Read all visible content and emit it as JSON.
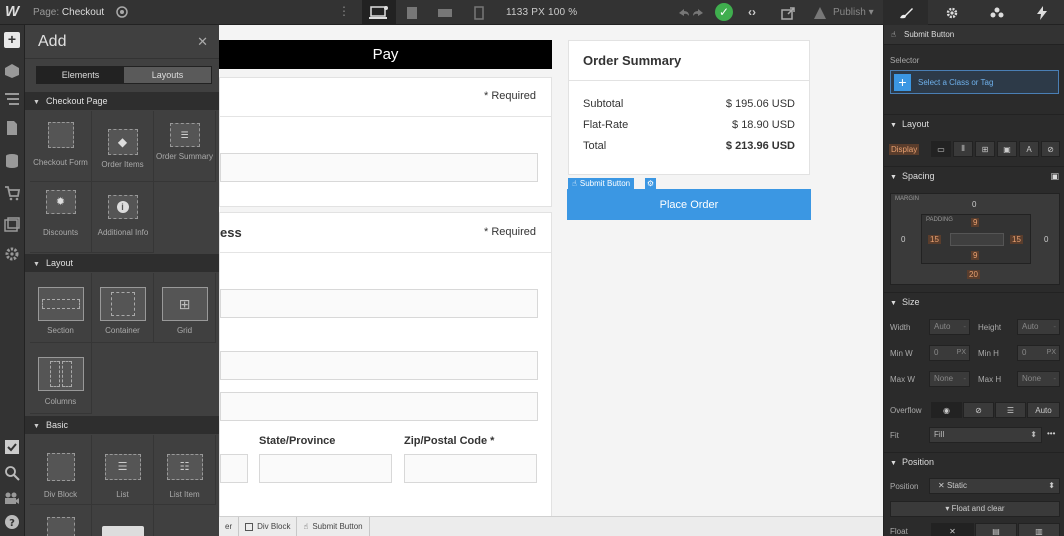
{
  "topbar": {
    "logo": "W",
    "page_prefix": "Page:",
    "page_name": "Checkout",
    "dimensions": "1133 PX  100 %",
    "publish_label": "Publish"
  },
  "add_panel": {
    "title": "Add",
    "close": "✕",
    "tabs": [
      "Elements",
      "Layouts"
    ],
    "sections": [
      {
        "title": "Checkout Page",
        "items": [
          "Checkout Form",
          "Order Items",
          "Order Summary",
          "Discounts",
          "Additional Info"
        ]
      },
      {
        "title": "Layout",
        "items": [
          "Section",
          "Container",
          "Grid",
          "Columns"
        ]
      },
      {
        "title": "Basic",
        "items": [
          "Div Block",
          "List",
          "List Item"
        ]
      }
    ]
  },
  "canvas": {
    "apple_pay": " Pay",
    "required_label": "* Required",
    "section_title_fragment": "ess",
    "state_label": "State/Province",
    "zip_label": "Zip/Postal Code *",
    "order_summary": {
      "title": "Order Summary",
      "rows": [
        {
          "label": "Subtotal",
          "value": "$ 195.06 USD"
        },
        {
          "label": "Flat-Rate",
          "value": "$ 18.90 USD"
        },
        {
          "label": "Total",
          "value": "$ 213.96 USD"
        }
      ]
    },
    "submit_tag": "Submit Button",
    "place_order": "Place Order"
  },
  "breadcrumbs": [
    "er",
    "Div Block",
    "Submit Button"
  ],
  "right_panel": {
    "element": "Submit Button",
    "selector_label": "Selector",
    "selector_placeholder": "Select a Class or Tag",
    "layout_title": "Layout",
    "display_label": "Display",
    "spacing_title": "Spacing",
    "margin_label": "MARGIN",
    "padding_label": "PADDING",
    "margin": {
      "top": "0",
      "right": "0",
      "bottom": "20",
      "left": "0"
    },
    "padding": {
      "top": "9",
      "right": "15",
      "bottom": "9",
      "left": "15"
    },
    "size_title": "Size",
    "size": {
      "width_label": "Width",
      "width": "Auto",
      "height_label": "Height",
      "height": "Auto",
      "minw_label": "Min W",
      "minw": "0",
      "minw_unit": "PX",
      "minh_label": "Min H",
      "minh": "0",
      "minh_unit": "PX",
      "maxw_label": "Max W",
      "maxw": "None",
      "maxh_label": "Max H",
      "maxh": "None"
    },
    "overflow_label": "Overflow",
    "overflow_auto": "Auto",
    "fit_label": "Fit",
    "fit_value": "Fill",
    "position_title": "Position",
    "position_label": "Position",
    "position_value": "Static",
    "float_clear": "Float and clear",
    "float_label": "Float"
  },
  "colors": {
    "accent": "#3b97e3",
    "success": "#3fae4e",
    "padding_num": "#e8a070"
  }
}
